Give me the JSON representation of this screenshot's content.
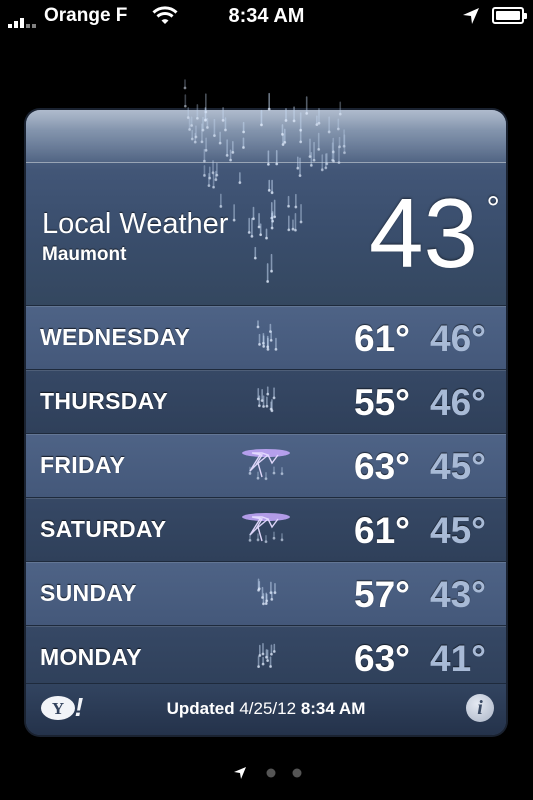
{
  "status_bar": {
    "carrier": "Orange F",
    "time": "8:34 AM"
  },
  "weather": {
    "title": "Local Weather",
    "city": "Maumont",
    "current_temp": "43",
    "degree_symbol": "°",
    "condition_icon": "rain-icon",
    "forecast": [
      {
        "day": "WEDNESDAY",
        "high": "61°",
        "low": "46°",
        "icon": "rain-icon"
      },
      {
        "day": "THURSDAY",
        "high": "55°",
        "low": "46°",
        "icon": "rain-icon"
      },
      {
        "day": "FRIDAY",
        "high": "63°",
        "low": "45°",
        "icon": "thunderstorm-icon"
      },
      {
        "day": "SATURDAY",
        "high": "61°",
        "low": "45°",
        "icon": "thunderstorm-icon"
      },
      {
        "day": "SUNDAY",
        "high": "57°",
        "low": "43°",
        "icon": "rain-icon"
      },
      {
        "day": "MONDAY",
        "high": "63°",
        "low": "41°",
        "icon": "rain-icon"
      }
    ],
    "footer": {
      "updated_label": "Updated",
      "updated_date": "4/25/12",
      "updated_time": "8:34 AM",
      "logo": "Y!",
      "info_icon": "i"
    }
  },
  "page_control": {
    "pages": 3,
    "current": 0
  },
  "colors": {
    "card": "#3a4d6b",
    "low_temp": "#a8bad6",
    "background": "#000000"
  }
}
